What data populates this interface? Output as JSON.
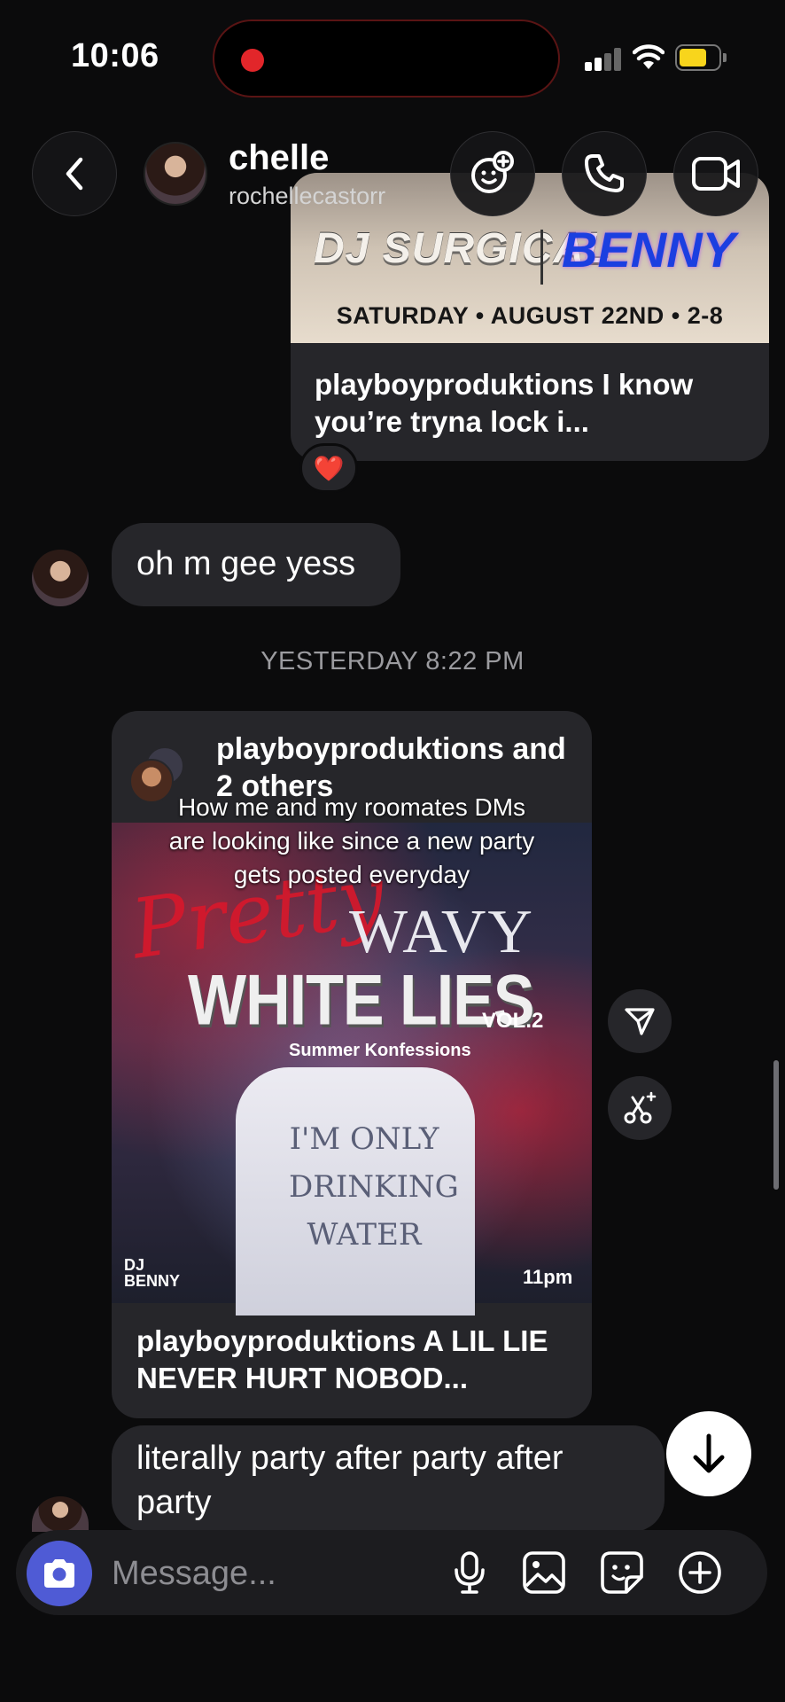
{
  "status_bar": {
    "time": "10:06",
    "battery_level": 0.72,
    "battery_color": "#f8d51c",
    "recording_color": "#e2262a"
  },
  "header": {
    "name": "chelle",
    "handle": "rochellecastorr",
    "icons": [
      "back-icon",
      "effects-icon",
      "phone-icon",
      "video-icon"
    ]
  },
  "shared_post_1": {
    "flyer_dj": "DJ SURGICAL",
    "flyer_benny": "BENNY",
    "flyer_date": "SATURDAY • AUGUST 22ND • 2-8",
    "caption": "playboyproduktions I know you’re tryna lock i...",
    "reaction": "❤️"
  },
  "messages": {
    "msg1": "oh m gee yess",
    "timestamp": "YESTERDAY 8:22 PM",
    "msg2": "literally party after party after party"
  },
  "shared_post_2": {
    "author": "playboyproduktions and 2 others",
    "overlay_text": "How me and my roomates DMs are looking like since a new party gets posted everyday",
    "flyer_pretty": "Pretty",
    "flyer_wavy": "WAVY",
    "flyer_title": "WHITE LIES",
    "flyer_vol": "VOL.2",
    "flyer_subtitle": "Summer Konfessions",
    "flyer_shirt": "I'M ONLY DRINKING WATER",
    "flyer_dj": "DJ BENNY",
    "flyer_time": "11pm",
    "caption": "playboyproduktions A LIL LIE NEVER HURT NOBOD..."
  },
  "composer": {
    "placeholder": "Message...",
    "accent": "#4f5bd5",
    "icons": [
      "camera-icon",
      "microphone-icon",
      "gallery-icon",
      "sticker-icon",
      "plus-icon"
    ]
  }
}
